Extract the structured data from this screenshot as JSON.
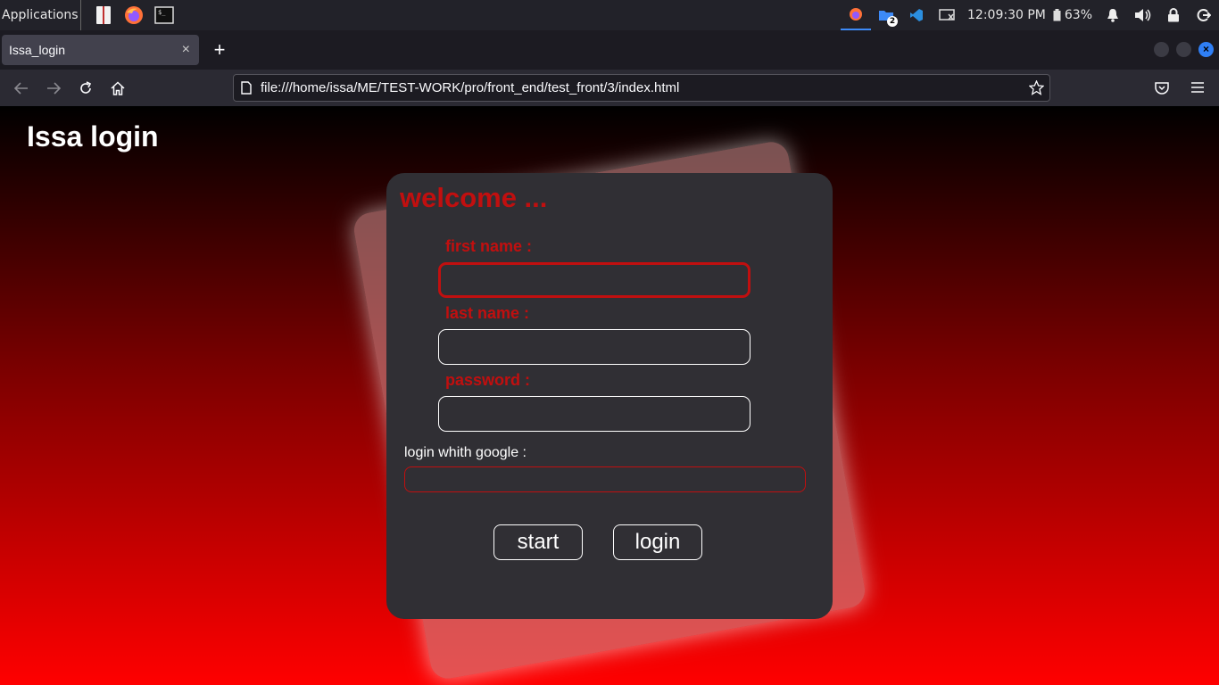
{
  "taskbar": {
    "apps_label": "Applications",
    "launchers": [
      "files-icon",
      "firefox-icon",
      "terminal-icon"
    ],
    "tray": {
      "folder_badge": "2",
      "clock": "12:09:30 PM",
      "battery": "63%"
    }
  },
  "browser": {
    "tab_title": "Issa_login",
    "tab_close": "×",
    "new_tab": "+",
    "url": "file:///home/issa/ME/TEST-WORK/pro/front_end/test_front/3/index.html",
    "window_close": "×"
  },
  "page": {
    "title": "Issa login",
    "welcome": "welcome ...",
    "fields": {
      "first_name_label": "first name :",
      "first_name_value": "",
      "last_name_label": "last name :",
      "last_name_value": "",
      "password_label": "password :",
      "password_value": ""
    },
    "google_label": "login whith google :",
    "google_value": "",
    "start_label": "start",
    "login_label": "login"
  },
  "colors": {
    "accent": "#c10f0f",
    "card": "#302f34",
    "gradient_top": "#000000",
    "gradient_bottom": "#ff0000"
  }
}
